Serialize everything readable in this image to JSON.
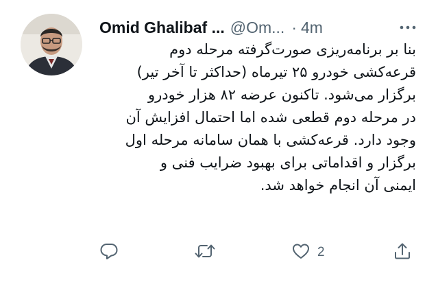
{
  "tweet": {
    "author_name": "Omid Ghalibaf ...",
    "handle": "@Om...",
    "separator": "·",
    "time": "4m",
    "text_lines": [
      "بنا بر برنامه‌ریزی صورت‌گرفته مرحله دوم",
      "قرعه‌کشی خودرو ۲۵ تیرماه (حداکثر تا آخر تیر)",
      "برگزار می‌شود. تاکنون عرضه ۸۲ هزار خودرو",
      "در مرحله دوم قطعی شده اما احتمال افزایش آن",
      "وجود دارد. قرعه‌کشی با همان سامانه مرحله اول",
      "برگزار و اقداماتی برای بهبود ضرایب فنی و",
      "ایمنی آن انجام خواهد شد."
    ],
    "actions": {
      "reply_icon": "reply-icon",
      "retweet_icon": "retweet-icon",
      "like_icon": "heart-icon",
      "like_count": "2",
      "share_icon": "share-icon"
    },
    "more_icon": "more-options-icon"
  },
  "colors": {
    "text": "#0f1419",
    "secondary": "#536471",
    "background": "#ffffff"
  }
}
